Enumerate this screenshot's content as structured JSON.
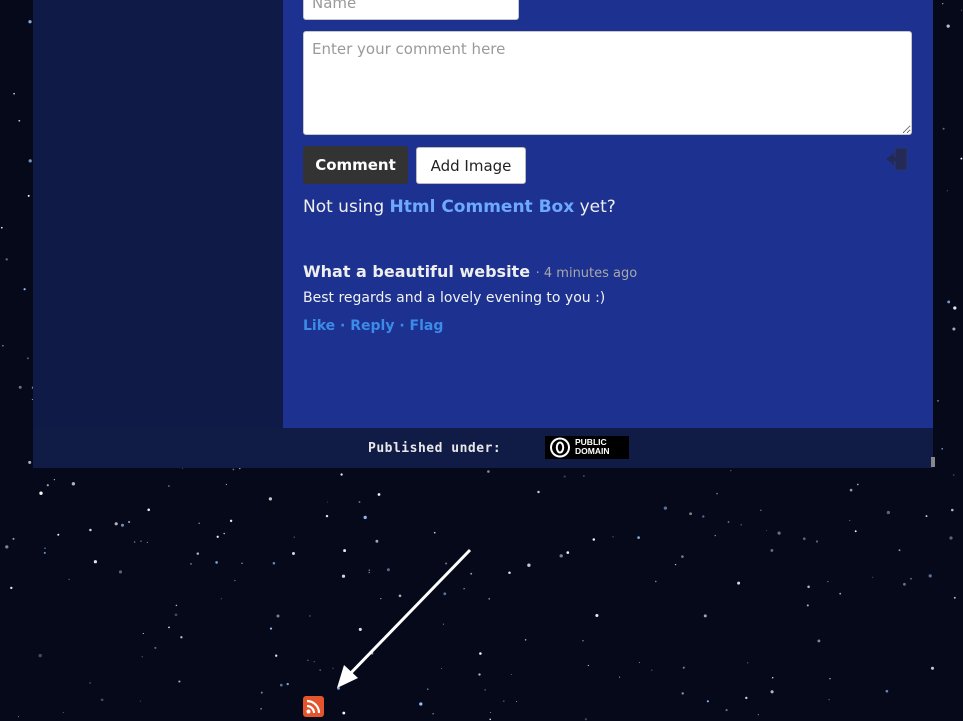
{
  "form": {
    "name_placeholder": "Name",
    "comment_placeholder": "Enter your comment here",
    "comment_button": "Comment",
    "add_image_button": "Add Image"
  },
  "promo": {
    "prefix": "Not using",
    "link": "Html Comment Box",
    "suffix": "yet?"
  },
  "comment": {
    "author": "What a beautiful website",
    "time": "· 4 minutes ago",
    "body": "Best regards and a lovely evening to you :)",
    "actions": {
      "like": "Like",
      "reply": "Reply",
      "flag": "Flag",
      "separator": "·"
    }
  },
  "footer": {
    "published_label": "Published under:",
    "license_line1": "PUBLIC",
    "license_line2": "DOMAIN"
  },
  "icons": {
    "logout": "logout-icon",
    "rss": "rss-icon",
    "pointer": "arrow-icon"
  },
  "colors": {
    "main_panel": "#1c3190",
    "sidebar": "#0f1a47",
    "link": "#6fa8ff",
    "action_link": "#3d8be8",
    "comment_button": "#333333",
    "rss": "#e4542d"
  }
}
